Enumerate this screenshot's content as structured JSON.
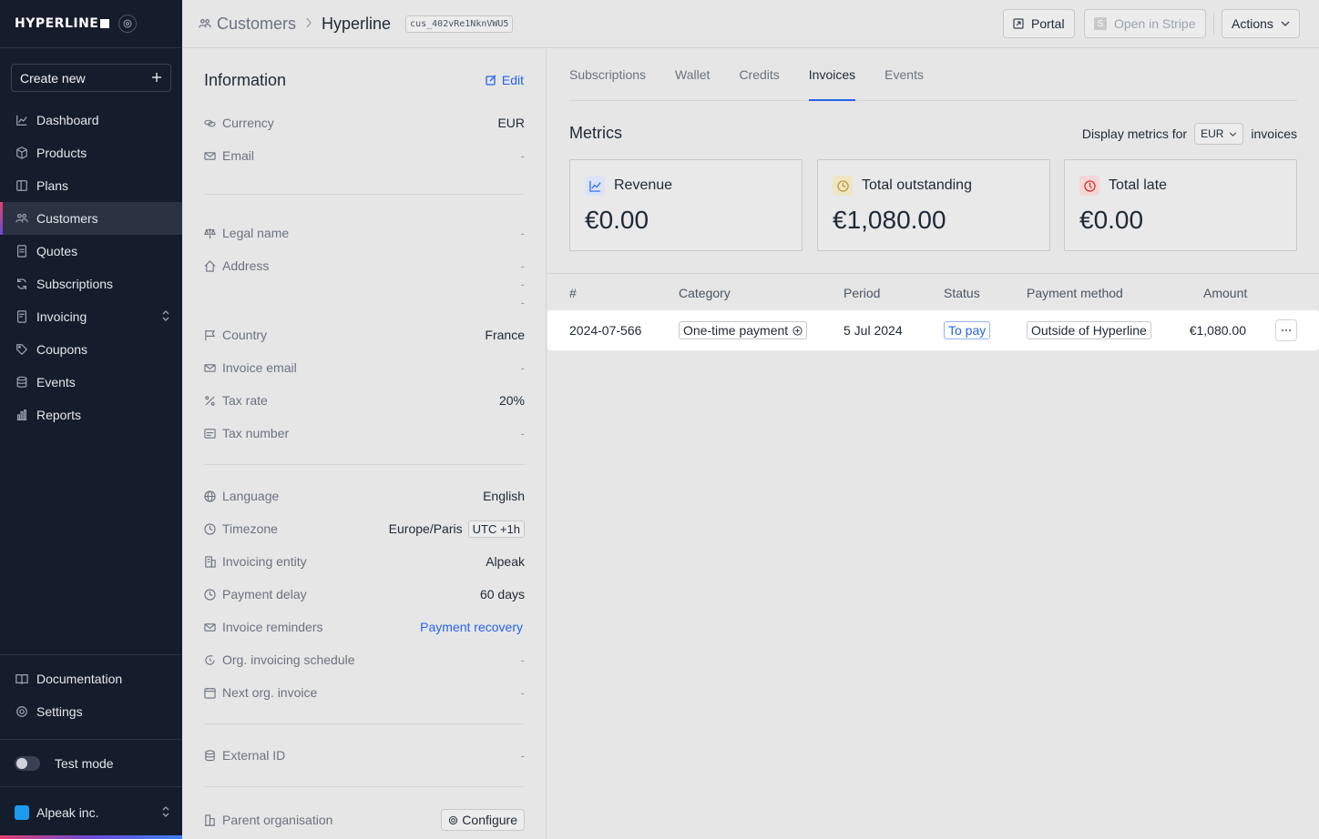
{
  "sidebar": {
    "logo": "HYPERLINE",
    "create_new": "Create new",
    "items": [
      {
        "label": "Dashboard",
        "icon": "chart-line-icon"
      },
      {
        "label": "Products",
        "icon": "box-icon"
      },
      {
        "label": "Plans",
        "icon": "plans-icon"
      },
      {
        "label": "Customers",
        "icon": "users-icon",
        "active": true
      },
      {
        "label": "Quotes",
        "icon": "quote-icon"
      },
      {
        "label": "Subscriptions",
        "icon": "refresh-icon"
      },
      {
        "label": "Invoicing",
        "icon": "invoice-icon",
        "expandable": true
      },
      {
        "label": "Coupons",
        "icon": "tag-icon"
      },
      {
        "label": "Events",
        "icon": "database-icon"
      },
      {
        "label": "Reports",
        "icon": "bar-chart-icon"
      }
    ],
    "bottom_items": [
      {
        "label": "Documentation",
        "icon": "book-icon"
      },
      {
        "label": "Settings",
        "icon": "gear-icon"
      }
    ],
    "test_mode": "Test mode",
    "org_name": "Alpeak inc."
  },
  "topbar": {
    "parent": "Customers",
    "current": "Hyperline",
    "customer_id": "cus_402vRe1NknVWU5",
    "portal": "Portal",
    "open_in_stripe": "Open in Stripe",
    "actions": "Actions"
  },
  "info": {
    "title": "Information",
    "edit": "Edit",
    "currency": {
      "label": "Currency",
      "value": "EUR"
    },
    "email": {
      "label": "Email",
      "value": "-"
    },
    "legal_name": {
      "label": "Legal name",
      "value": "-"
    },
    "address": {
      "label": "Address",
      "values": [
        "-",
        "-",
        "-"
      ]
    },
    "country": {
      "label": "Country",
      "value": "France"
    },
    "invoice_email": {
      "label": "Invoice email",
      "value": "-"
    },
    "tax_rate": {
      "label": "Tax rate",
      "value": "20%"
    },
    "tax_number": {
      "label": "Tax number",
      "value": "-"
    },
    "language": {
      "label": "Language",
      "value": "English"
    },
    "timezone": {
      "label": "Timezone",
      "value": "Europe/Paris",
      "offset": "UTC +1h"
    },
    "invoicing_entity": {
      "label": "Invoicing entity",
      "value": "Alpeak"
    },
    "payment_delay": {
      "label": "Payment delay",
      "value": "60 days"
    },
    "invoice_reminders": {
      "label": "Invoice reminders",
      "value": "Payment recovery"
    },
    "org_invoicing_schedule": {
      "label": "Org. invoicing schedule",
      "value": "-"
    },
    "next_org_invoice": {
      "label": "Next org. invoice",
      "value": "-"
    },
    "external_id": {
      "label": "External ID",
      "value": "-"
    },
    "parent_org": {
      "label": "Parent organisation",
      "button": "Configure"
    }
  },
  "main": {
    "tabs": [
      {
        "label": "Subscriptions"
      },
      {
        "label": "Wallet"
      },
      {
        "label": "Credits"
      },
      {
        "label": "Invoices",
        "active": true
      },
      {
        "label": "Events"
      }
    ],
    "metrics_title": "Metrics",
    "display_for": "Display metrics for",
    "currency_select": "EUR",
    "invoices_suffix": "invoices",
    "cards": [
      {
        "label": "Revenue",
        "value": "€0.00",
        "icon": "trend-icon",
        "color": "#2563eb",
        "bg": "#dbe4f7"
      },
      {
        "label": "Total outstanding",
        "value": "€1,080.00",
        "icon": "clock-icon",
        "color": "#b7952a",
        "bg": "#efe6c3"
      },
      {
        "label": "Total late",
        "value": "€0.00",
        "icon": "alarm-icon",
        "color": "#dc2626",
        "bg": "#f3d6d6"
      }
    ],
    "table": {
      "headers": [
        "#",
        "Category",
        "Period",
        "Status",
        "Payment method",
        "Amount"
      ],
      "rows": [
        {
          "number": "2024-07-566",
          "category": "One-time payment",
          "period": "5 Jul 2024",
          "status": "To pay",
          "method": "Outside of Hyperline",
          "amount": "€1,080.00"
        }
      ]
    }
  }
}
